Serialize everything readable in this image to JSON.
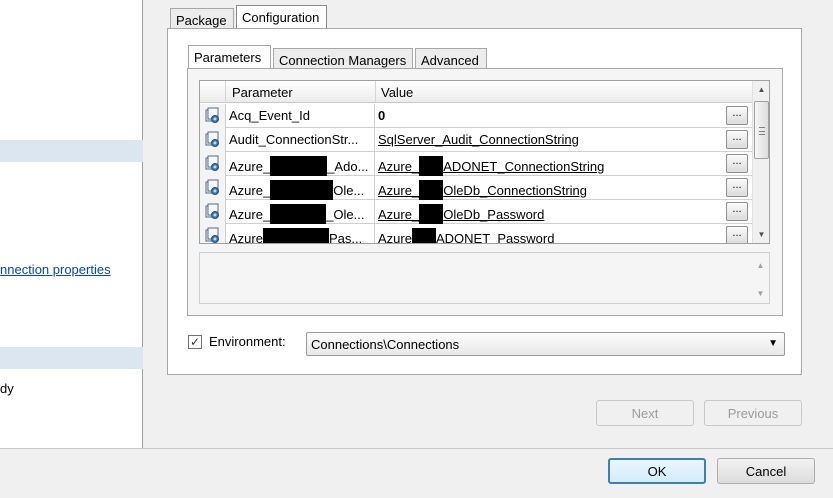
{
  "left_pane": {
    "link_text": "nnection properties",
    "text": "dy"
  },
  "top_tabs": [
    "Package",
    "Configuration"
  ],
  "inner_tabs": [
    "Parameters",
    "Connection Managers",
    "Advanced"
  ],
  "grid": {
    "columns": [
      "Parameter",
      "Value"
    ],
    "rows": [
      {
        "param": [
          "Acq_Event_Id"
        ],
        "value": [
          "0"
        ],
        "value_style": "bold"
      },
      {
        "param": [
          "Audit_ConnectionStr..."
        ],
        "value": [
          "SqlServer_Audit_ConnectionString"
        ],
        "value_style": "bound"
      },
      {
        "param": [
          "Azure_",
          "",
          "_Ado..."
        ],
        "value": [
          "Azure_",
          "",
          "ADONET_ConnectionString"
        ],
        "value_style": "bound"
      },
      {
        "param": [
          "Azure_",
          "",
          "Ole..."
        ],
        "value": [
          "Azure_",
          "",
          "OleDb_ConnectionString"
        ],
        "value_style": "bound"
      },
      {
        "param": [
          "Azure_",
          "",
          "_Ole..."
        ],
        "value": [
          "Azure_",
          "",
          "OleDb_Password"
        ],
        "value_style": "bound"
      },
      {
        "param": [
          "Azure",
          "",
          "Pas..."
        ],
        "value": [
          "Azure",
          "",
          "ADONET_Password"
        ],
        "value_style": "plain"
      }
    ],
    "ellipsis": "..."
  },
  "environment": {
    "checked": true,
    "label": "Environment:",
    "selected": "Connections\\Connections"
  },
  "wizard": {
    "next": "Next",
    "previous": "Previous"
  },
  "dialog": {
    "ok": "OK",
    "cancel": "Cancel"
  },
  "colors": {
    "link": "#0645c8",
    "band": "#dbe6f1",
    "primary_border": "#3c7fb1"
  },
  "icons": {
    "row_icon": "parameter-icon",
    "scroll_up": "scroll-up-arrow-icon",
    "scroll_down": "scroll-down-arrow-icon",
    "dropdown": "dropdown-arrow-icon",
    "check": "checkmark-icon"
  }
}
